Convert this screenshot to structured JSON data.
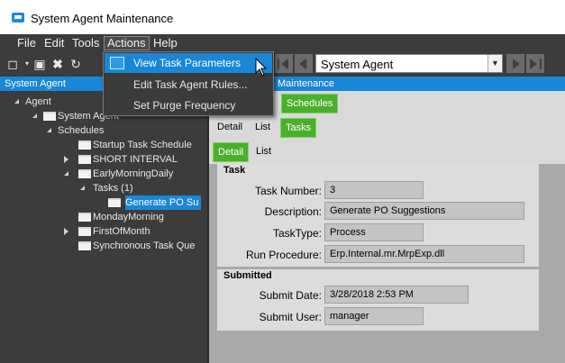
{
  "window": {
    "title": "System Agent Maintenance"
  },
  "menubar": {
    "file": "File",
    "edit": "Edit",
    "tools": "Tools",
    "actions": "Actions",
    "help": "Help"
  },
  "actions_menu": {
    "items": [
      {
        "label": "View Task Parameters"
      },
      {
        "label": "Edit Task Agent Rules..."
      },
      {
        "label": "Set Purge Frequency"
      }
    ]
  },
  "toolbar": {
    "agent_selector_value": "System Agent"
  },
  "left_panel": {
    "header": "System Agent"
  },
  "right_panel": {
    "header": "Maintenance"
  },
  "tree": {
    "agent": "Agent",
    "system_agent": "System Agent",
    "schedules": "Schedules",
    "items": [
      {
        "label": "Startup Task Schedule"
      },
      {
        "label": "SHORT INTERVAL"
      },
      {
        "label": "EarlyMorningDaily"
      },
      {
        "label": "Tasks (1)"
      },
      {
        "label": "Generate PO Su"
      },
      {
        "label": "MondayMorning"
      },
      {
        "label": "FirstOfMonth"
      },
      {
        "label": "Synchronous Task Que"
      }
    ]
  },
  "tabs": {
    "schedules": "Schedules",
    "detail1": "Detail",
    "list1": "List",
    "tasks": "Tasks",
    "detail2": "Detail",
    "list2": "List"
  },
  "task": {
    "section_title": "Task",
    "task_number_label": "Task Number:",
    "task_number": "3",
    "description_label": "Description:",
    "description": "Generate PO Suggestions",
    "task_type_label": "TaskType:",
    "task_type": "Process",
    "run_procedure_label": "Run Procedure:",
    "run_procedure": "Erp.Internal.mr.MrpExp.dll"
  },
  "submitted": {
    "section_title": "Submitted",
    "submit_date_label": "Submit Date:",
    "submit_date": "3/28/2018 2:53 PM",
    "submit_user_label": "Submit User:",
    "submit_user": "manager"
  },
  "colors": {
    "accent": "#1987d6",
    "tab_green": "#4caf2c"
  }
}
